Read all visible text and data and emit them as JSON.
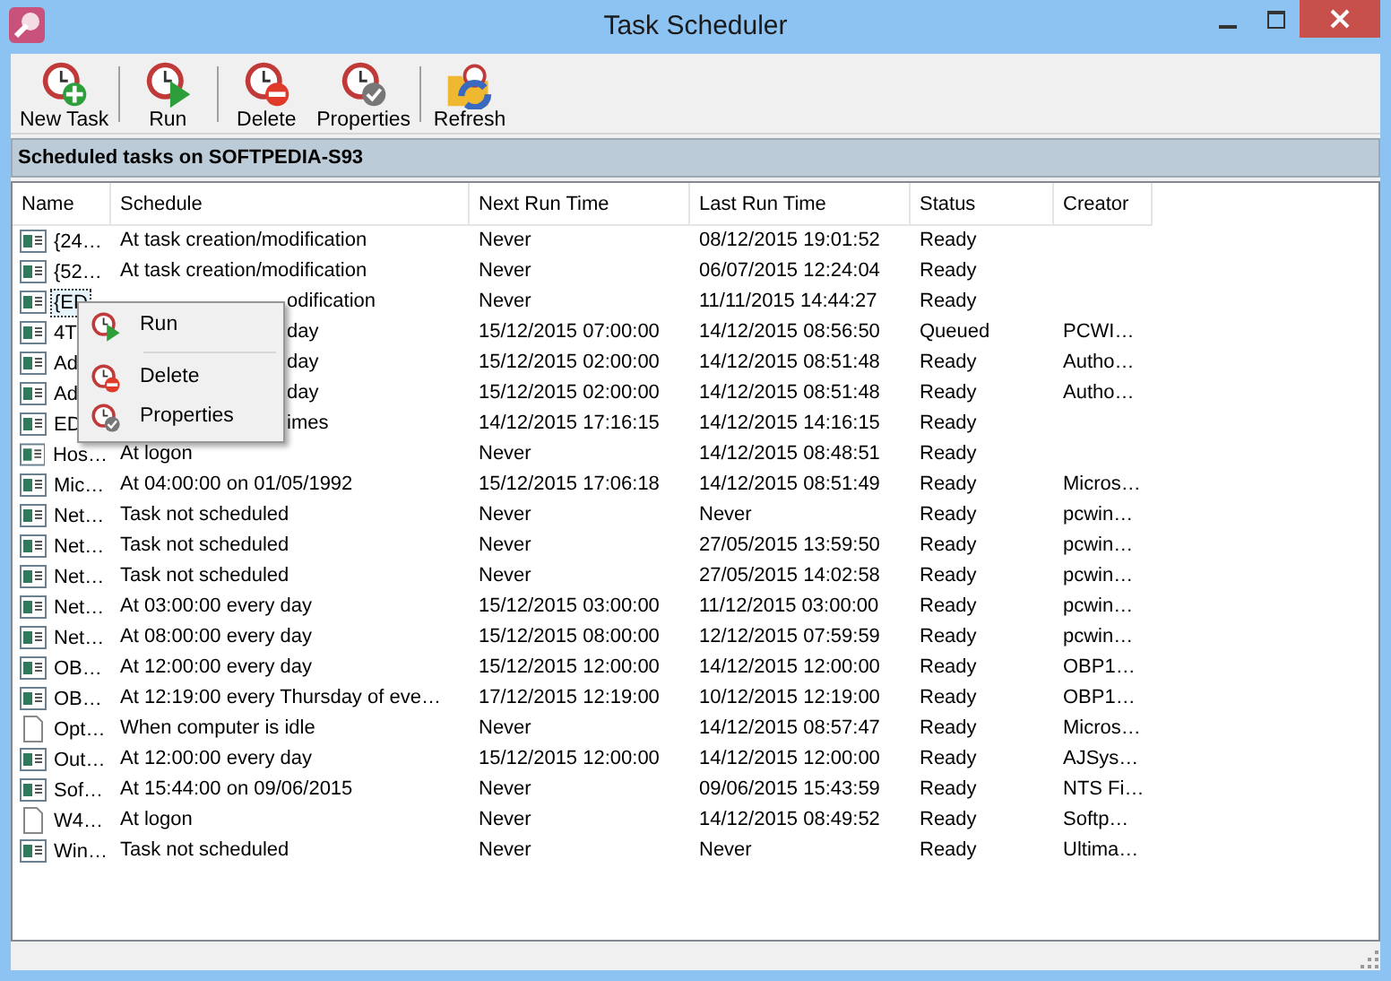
{
  "window": {
    "title": "Task Scheduler"
  },
  "toolbar": [
    {
      "label": "New Task",
      "kind": "new"
    },
    {
      "label": "Run",
      "kind": "run"
    },
    {
      "label": "Delete",
      "kind": "delete"
    },
    {
      "label": "Properties",
      "kind": "properties"
    },
    {
      "label": "Refresh",
      "kind": "refresh"
    }
  ],
  "header": "Scheduled tasks on SOFTPEDIA-S93",
  "table": {
    "columns": [
      "Name",
      "Schedule",
      "Next Run Time",
      "Last Run Time",
      "Status",
      "Creator"
    ],
    "rows": [
      {
        "kind": "app",
        "selected": false,
        "name": "{24…",
        "schedule": "At task creation/modification",
        "next_run": "Never",
        "last_run": "08/12/2015 19:01:52",
        "status": "Ready"
      },
      {
        "kind": "app",
        "selected": false,
        "name": "{52…",
        "schedule": "At task creation/modification",
        "next_run": "Never",
        "last_run": "06/07/2015 12:24:04",
        "status": "Ready"
      },
      {
        "kind": "app",
        "selected": true,
        "name": "{ED",
        "schedule": "odification",
        "schedule_covered": true,
        "next_run": "Never",
        "last_run": "11/11/2015 14:44:27",
        "status": "Ready"
      },
      {
        "kind": "app",
        "selected": false,
        "name": "4T",
        "schedule": "day",
        "schedule_covered": true,
        "next_run": "15/12/2015 07:00:00",
        "last_run": "14/12/2015 08:56:50",
        "status": "Queued",
        "creator": "PCWI…"
      },
      {
        "kind": "app",
        "selected": false,
        "name": "Ad",
        "schedule": "day",
        "schedule_covered": true,
        "next_run": "15/12/2015 02:00:00",
        "last_run": "14/12/2015 08:51:48",
        "status": "Ready",
        "creator": "Autho…"
      },
      {
        "kind": "app",
        "selected": false,
        "name": "Ad",
        "schedule": "day",
        "schedule_covered": true,
        "next_run": "15/12/2015 02:00:00",
        "last_run": "14/12/2015 08:51:48",
        "status": "Ready",
        "creator": "Autho…"
      },
      {
        "kind": "app",
        "selected": false,
        "name": "ED",
        "schedule": "imes",
        "schedule_covered": true,
        "next_run": "14/12/2015 17:16:15",
        "last_run": "14/12/2015 14:16:15",
        "status": "Ready"
      },
      {
        "kind": "app",
        "selected": false,
        "name": "Hos…",
        "schedule": "At logon",
        "next_run": "Never",
        "last_run": "14/12/2015 08:48:51",
        "status": "Ready"
      },
      {
        "kind": "app",
        "selected": false,
        "name": "Mic…",
        "schedule": "At 04:00:00 on 01/05/1992",
        "next_run": "15/12/2015 17:06:18",
        "last_run": "14/12/2015 08:51:49",
        "status": "Ready",
        "creator": "Micros…"
      },
      {
        "kind": "app",
        "selected": false,
        "name": "Net…",
        "schedule": "Task not scheduled",
        "next_run": "Never",
        "last_run": "Never",
        "status": "Ready",
        "creator": "pcwin…"
      },
      {
        "kind": "app",
        "selected": false,
        "name": "Net…",
        "schedule": "Task not scheduled",
        "next_run": "Never",
        "last_run": "27/05/2015 13:59:50",
        "status": "Ready",
        "creator": "pcwin…"
      },
      {
        "kind": "app",
        "selected": false,
        "name": "Net…",
        "schedule": "Task not scheduled",
        "next_run": "Never",
        "last_run": "27/05/2015 14:02:58",
        "status": "Ready",
        "creator": "pcwin…"
      },
      {
        "kind": "app",
        "selected": false,
        "name": "Net…",
        "schedule": "At 03:00:00 every day",
        "next_run": "15/12/2015 03:00:00",
        "last_run": "11/12/2015 03:00:00",
        "status": "Ready",
        "creator": "pcwin…"
      },
      {
        "kind": "app",
        "selected": false,
        "name": "Net…",
        "schedule": "At 08:00:00 every day",
        "next_run": "15/12/2015 08:00:00",
        "last_run": "12/12/2015 07:59:59",
        "status": "Ready",
        "creator": "pcwin…"
      },
      {
        "kind": "app",
        "selected": false,
        "name": "OB…",
        "schedule": "At 12:00:00 every day",
        "next_run": "15/12/2015 12:00:00",
        "last_run": "14/12/2015 12:00:00",
        "status": "Ready",
        "creator": "OBP1…"
      },
      {
        "kind": "app",
        "selected": false,
        "name": "OB…",
        "schedule": "At 12:19:00 every Thursday of eve…",
        "next_run": "17/12/2015 12:19:00",
        "last_run": "10/12/2015 12:19:00",
        "status": "Ready",
        "creator": "OBP1…"
      },
      {
        "kind": "doc",
        "selected": false,
        "name": "Opt…",
        "schedule": "When computer is idle",
        "next_run": "Never",
        "last_run": "14/12/2015 08:57:47",
        "status": "Ready",
        "creator": "Micros…"
      },
      {
        "kind": "app",
        "selected": false,
        "name": "Out…",
        "schedule": "At 12:00:00 every day",
        "next_run": "15/12/2015 12:00:00",
        "last_run": "14/12/2015 12:00:00",
        "status": "Ready",
        "creator": "AJSys…"
      },
      {
        "kind": "app",
        "selected": false,
        "name": "Sof…",
        "schedule": "At 15:44:00 on 09/06/2015",
        "next_run": "Never",
        "last_run": "09/06/2015 15:43:59",
        "status": "Ready",
        "creator": "NTS Fi…"
      },
      {
        "kind": "doc",
        "selected": false,
        "name": "W4…",
        "schedule": "At logon",
        "next_run": "Never",
        "last_run": "14/12/2015 08:49:52",
        "status": "Ready",
        "creator": "Softp…"
      },
      {
        "kind": "app",
        "selected": false,
        "name": "Win…",
        "schedule": "Task not scheduled",
        "next_run": "Never",
        "last_run": "Never",
        "status": "Ready",
        "creator": "Ultima…"
      }
    ]
  },
  "context_menu": [
    {
      "label": "Run",
      "kind": "run"
    },
    {
      "label": "Delete",
      "kind": "delete"
    },
    {
      "label": "Properties",
      "kind": "properties"
    }
  ]
}
